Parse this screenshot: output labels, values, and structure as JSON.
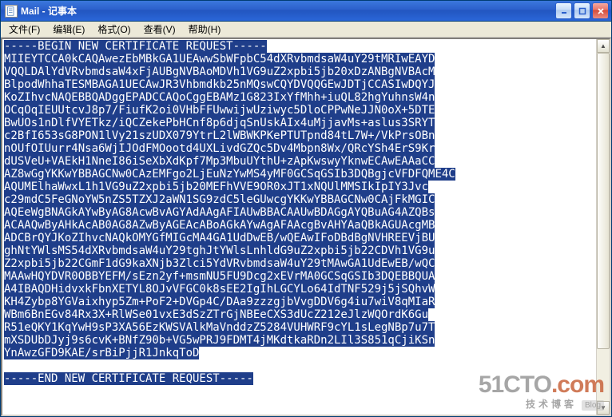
{
  "titlebar": {
    "title": "Mail - 记事本"
  },
  "menu": {
    "file": "文件(F)",
    "edit": "编辑(E)",
    "format": "格式(O)",
    "view": "查看(V)",
    "help": "帮助(H)"
  },
  "content": {
    "lines": [
      "-----BEGIN NEW CERTIFICATE REQUEST-----",
      "MIIEYTCCA0kCAQAwezEbMBkGA1UEAwwSbWFpbC54dXRvbmdsaW4uY29tMRIwEAYD",
      "VQQLDAlYdVRvbmdsaW4xFjAUBgNVBAoMDVh1VG9uZ2xpbi5jb20xDzANBgNVBAcM",
      "BlpodWhhaTESMBAGA1UECAwJR3Vhbmdkb25nMQswCQYDVQQGEwJDTjCCASIwDQYJ",
      "KoZIhvcNAQEBBQADggEPADCCAQoCggEBAMz1G823IxYfMhh+iuQL82hgYuhnsW4n",
      "OCqOqIEUUtcvJ8p7/FiufK2oi0VHbFFUwwijwUziwyc5DloCPPwNeJJN0oX+5DTE",
      "BwUOs1nDlfVYETkz/iQCZekePbHCnf8p6djqSnUskAIx4uMjjavMs+aslus3SRYT",
      "c2BfI653sG8PON1lVy21szUDX079YtrL2lWBWKPKePTUTpnd84tL7W+/VkPrsOBn",
      "nOUfOIUurr4Nsa6WjIJOdFMOootd4UXLivdGZQc5Dv4Mbpn8Wx/QRcYSh4ErS9Kr",
      "dUSVeU+VAEkH1NneI86iSeXbXdKpf7Mp3MbuUYthU+zApKwswyYknwECAwEAAaCC",
      "AZ8wGgYKKwYBBAGCNw0CAzEMFgo2LjEuNzYwMS4yMF0GCSqGSIb3DQBgjcVFDFQME4C",
      "AQUMElhaWwxL1h1VG9uZ2xpbi5jb20MEFhVVE9OR0xJT1xNQUlMMSIkIpIY3Jvc",
      "c29mdC5FeGNoYW5nZS5TZXJ2aWN1SG9zdC5leGUwcgYKKwYBBAGCNw0CAjFkMGIC",
      "AQEeWgBNAGkAYwByAG8AcwBvAGYAdAAgAFIAUwBBACAAUwBDAGgAYQBuAG4AZQBs",
      "ACAAQwByAHkAcAB0AG8AZwByAGEAcABoAGkAYwAgAFAAcgBvAHYAaQBkAGUAcgMB",
      "ADCBrQYJKoZIhvcNAQkOMYGfMIGcMA4GA1UdDwEB/wQEAwIFoDBdBgNVHREEVjBU",
      "ghNtYWlsMS54dXRvbmdsaW4uY29tghJtYWlsLnhldG9uZ2xpbi5jb22CDVh1VG9u",
      "Z2xpbi5jb22CGmF1dG9kaXNjb3Zlci5YdVRvbmdsaW4uY29tMAwGA1UdEwEB/wQC",
      "MAAwHQYDVR0OBBYEFM/sEzn2yf+msmNU5FU9Dcg2xEVrMA0GCSqGSIb3DQEBBQUA",
      "A4IBAQDHidvxkFbnXETYL8OJvVFGC0k8sEE2IgIhLGCYLo64IdTNF529j5jSQhvW",
      "KH4Zybp8YGVaixhyp5Zm+PoF2+DVGp4C/DAa9zzzgjbVvgDDV6g4iu7wiV8qMIaR",
      "WBm6BnEGv84Rx3X+RlWSe01vxE3dSzZTrGjNBEeCXS3dUcZ212eJlzWQOrdK6Gu",
      "R51eQKY1KqYwH9sP3XA56EzKWSVAlkMaVnddzZ5284VUHWRF9cYL1sLegNBp7u7T",
      "mXSDUbDJyj9s6cvK+BNfZ90b+VG5wPRJ9FDMT4jMKdtkaRDn2LIl3S851qCjiKSn",
      "YnAwzGFD9KAE/srBiPjjR1JnkqToD",
      "",
      "-----END NEW CERTIFICATE REQUEST-----"
    ]
  },
  "watermark": {
    "brand_pre": "51CTO",
    "brand_suf": ".com",
    "sub": "技术博客",
    "blog": "Blog"
  }
}
